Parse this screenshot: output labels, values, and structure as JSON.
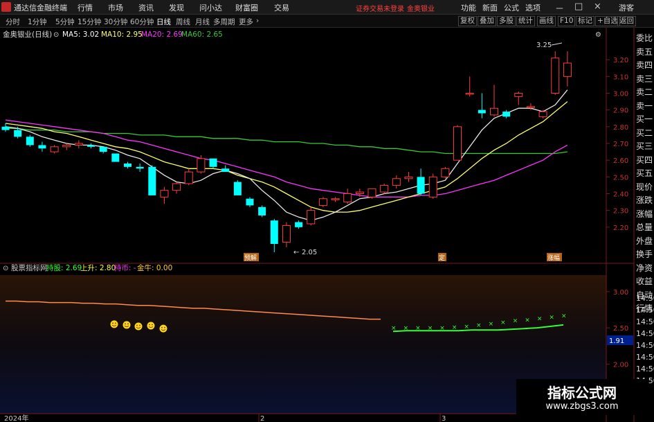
{
  "app": {
    "title": "通达信金融终端"
  },
  "menu": [
    "行情",
    "市场",
    "资讯",
    "发现",
    "问小达",
    "财富圈",
    "交易"
  ],
  "warning": {
    "text": "证券交易未登录",
    "stock_name": "金奥银业"
  },
  "topright": [
    "功能",
    "新面",
    "公式",
    "选项",
    "游客"
  ],
  "window_controls": [
    "－",
    "□",
    "×"
  ],
  "periods": [
    "分时",
    "1分钟",
    "5分钟",
    "15分钟",
    "30分钟",
    "60分钟",
    "日线",
    "周线",
    "月线",
    "多周期",
    "更多"
  ],
  "active_period": "日线",
  "tools": [
    "复权",
    "叠加",
    "多股",
    "统计",
    "画线",
    "F10",
    "标记",
    "+自选",
    "返回"
  ],
  "legend": {
    "stock_label": "金奥银业(日线)",
    "ma5_label": "MA5: 3.02",
    "ma10_label": "MA10: 2.95",
    "ma20_label": "MA20: 2.69",
    "ma60_label": "MA60: 2.65"
  },
  "price_axis": [
    "3.20",
    "3.10",
    "3.00",
    "2.90",
    "2.80",
    "2.70",
    "2.60",
    "2.50",
    "2.40",
    "2.30",
    "2.20"
  ],
  "annotations": {
    "high": "3.25",
    "low": "2.05",
    "tag1": "预解",
    "tag2": "定",
    "tag3": "涨幅"
  },
  "indicator": {
    "name": "股票指标网",
    "line1_label": "持股: 2.69",
    "line2_label": "上升: 2.80",
    "line3_label": "持币: -",
    "line4_label": "金牛: 0.00",
    "axis": [
      "3.00",
      "2.50",
      "2.00",
      "1.50"
    ],
    "current_value": "1.91"
  },
  "time_axis": [
    "2024年",
    "2",
    "3"
  ],
  "side_panel": [
    "委比",
    "卖五",
    "卖四",
    "卖三",
    "卖二",
    "卖一",
    "买一",
    "买二",
    "买三",
    "买四",
    "买五",
    "现价",
    "涨跌",
    "涨幅",
    "总量",
    "外盘",
    "换手",
    "净资",
    "收益",
    "自动",
    "行情"
  ],
  "side_times": [
    "14:50",
    "14:50",
    "14:50",
    "14:50",
    "14:50",
    "14:50",
    "14:50",
    "14:50"
  ],
  "watermark": {
    "title": "指标公式网",
    "url": "www.zbgs3.com"
  },
  "colors": {
    "up": "#ff3c3c",
    "down": "#00ffff",
    "ma5": "#ffffff",
    "ma10": "#ffff66",
    "ma20": "#ff33ff",
    "ma60": "#33cc33",
    "hold": "#ff8c4a",
    "rise": "#33ff33"
  },
  "chart_data": {
    "type": "candlestick",
    "candles": [
      {
        "o": 2.8,
        "h": 2.82,
        "l": 2.77,
        "c": 2.78
      },
      {
        "o": 2.78,
        "h": 2.8,
        "l": 2.73,
        "c": 2.74
      },
      {
        "o": 2.74,
        "h": 2.75,
        "l": 2.68,
        "c": 2.69
      },
      {
        "o": 2.69,
        "h": 2.71,
        "l": 2.65,
        "c": 2.67
      },
      {
        "o": 2.65,
        "h": 2.69,
        "l": 2.64,
        "c": 2.68
      },
      {
        "o": 2.68,
        "h": 2.7,
        "l": 2.66,
        "c": 2.69
      },
      {
        "o": 2.69,
        "h": 2.72,
        "l": 2.67,
        "c": 2.7
      },
      {
        "o": 2.69,
        "h": 2.7,
        "l": 2.67,
        "c": 2.68
      },
      {
        "o": 2.68,
        "h": 2.68,
        "l": 2.64,
        "c": 2.65
      },
      {
        "o": 2.64,
        "h": 2.64,
        "l": 2.59,
        "c": 2.59
      },
      {
        "o": 2.58,
        "h": 2.59,
        "l": 2.55,
        "c": 2.56
      },
      {
        "o": 2.56,
        "h": 2.58,
        "l": 2.53,
        "c": 2.55
      },
      {
        "o": 2.56,
        "h": 2.57,
        "l": 2.49,
        "c": 2.39
      },
      {
        "o": 2.38,
        "h": 2.44,
        "l": 2.34,
        "c": 2.42
      },
      {
        "o": 2.42,
        "h": 2.47,
        "l": 2.4,
        "c": 2.46
      },
      {
        "o": 2.46,
        "h": 2.55,
        "l": 2.45,
        "c": 2.53
      },
      {
        "o": 2.53,
        "h": 2.63,
        "l": 2.52,
        "c": 2.61
      },
      {
        "o": 2.61,
        "h": 2.61,
        "l": 2.55,
        "c": 2.56
      },
      {
        "o": 2.55,
        "h": 2.57,
        "l": 2.53,
        "c": 2.53
      },
      {
        "o": 2.47,
        "h": 2.48,
        "l": 2.39,
        "c": 2.39
      },
      {
        "o": 2.37,
        "h": 2.38,
        "l": 2.32,
        "c": 2.33
      },
      {
        "o": 2.32,
        "h": 2.33,
        "l": 2.26,
        "c": 2.27
      },
      {
        "o": 2.24,
        "h": 2.25,
        "l": 2.05,
        "c": 2.1
      },
      {
        "o": 2.11,
        "h": 2.23,
        "l": 2.08,
        "c": 2.21
      },
      {
        "o": 2.23,
        "h": 2.24,
        "l": 2.19,
        "c": 2.2
      },
      {
        "o": 2.22,
        "h": 2.32,
        "l": 2.21,
        "c": 2.3
      },
      {
        "o": 2.33,
        "h": 2.38,
        "l": 2.32,
        "c": 2.37
      },
      {
        "o": 2.37,
        "h": 2.38,
        "l": 2.35,
        "c": 2.37
      },
      {
        "o": 2.35,
        "h": 2.43,
        "l": 2.34,
        "c": 2.4
      },
      {
        "o": 2.4,
        "h": 2.43,
        "l": 2.38,
        "c": 2.41
      },
      {
        "o": 2.38,
        "h": 2.43,
        "l": 2.37,
        "c": 2.43
      },
      {
        "o": 2.41,
        "h": 2.46,
        "l": 2.4,
        "c": 2.45
      },
      {
        "o": 2.45,
        "h": 2.51,
        "l": 2.43,
        "c": 2.49
      },
      {
        "o": 2.49,
        "h": 2.53,
        "l": 2.47,
        "c": 2.5
      },
      {
        "o": 2.5,
        "h": 2.55,
        "l": 2.39,
        "c": 2.4
      },
      {
        "o": 2.38,
        "h": 2.52,
        "l": 2.37,
        "c": 2.5
      },
      {
        "o": 2.5,
        "h": 2.56,
        "l": 2.49,
        "c": 2.55
      },
      {
        "o": 2.6,
        "h": 2.81,
        "l": 2.6,
        "c": 2.8
      },
      {
        "o": 3.0,
        "h": 3.1,
        "l": 2.98,
        "c": 3.0
      },
      {
        "o": 2.9,
        "h": 3.0,
        "l": 2.85,
        "c": 2.88
      },
      {
        "o": 2.87,
        "h": 3.05,
        "l": 2.86,
        "c": 2.91
      },
      {
        "o": 2.89,
        "h": 2.9,
        "l": 2.85,
        "c": 2.86
      },
      {
        "o": 2.98,
        "h": 3.01,
        "l": 2.93,
        "c": 3.0
      },
      {
        "o": 2.92,
        "h": 2.94,
        "l": 2.9,
        "c": 2.92
      },
      {
        "o": 2.86,
        "h": 2.9,
        "l": 2.85,
        "c": 2.89
      },
      {
        "o": 3.0,
        "h": 3.25,
        "l": 2.99,
        "c": 3.21
      },
      {
        "o": 3.1,
        "h": 3.25,
        "l": 3.04,
        "c": 3.18
      }
    ],
    "ma5": [
      2.8,
      2.79,
      2.77,
      2.74,
      2.72,
      2.7,
      2.69,
      2.69,
      2.68,
      2.66,
      2.63,
      2.61,
      2.56,
      2.51,
      2.47,
      2.46,
      2.48,
      2.52,
      2.54,
      2.52,
      2.49,
      2.42,
      2.36,
      2.29,
      2.26,
      2.24,
      2.26,
      2.29,
      2.33,
      2.37,
      2.38,
      2.4,
      2.41,
      2.43,
      2.45,
      2.46,
      2.48,
      2.58,
      2.68,
      2.78,
      2.85,
      2.88,
      2.91,
      2.91,
      2.89,
      2.93,
      3.02
    ],
    "ma10": [
      2.82,
      2.81,
      2.8,
      2.79,
      2.77,
      2.76,
      2.74,
      2.72,
      2.7,
      2.68,
      2.67,
      2.65,
      2.62,
      2.59,
      2.57,
      2.55,
      2.55,
      2.55,
      2.54,
      2.51,
      2.49,
      2.47,
      2.44,
      2.4,
      2.36,
      2.32,
      2.3,
      2.29,
      2.29,
      2.3,
      2.32,
      2.34,
      2.36,
      2.38,
      2.4,
      2.42,
      2.44,
      2.49,
      2.55,
      2.61,
      2.66,
      2.7,
      2.75,
      2.79,
      2.83,
      2.89,
      2.95
    ],
    "ma20": [
      2.84,
      2.83,
      2.82,
      2.81,
      2.8,
      2.79,
      2.78,
      2.77,
      2.76,
      2.74,
      2.72,
      2.71,
      2.69,
      2.67,
      2.65,
      2.63,
      2.61,
      2.6,
      2.58,
      2.56,
      2.54,
      2.52,
      2.5,
      2.47,
      2.45,
      2.43,
      2.42,
      2.41,
      2.4,
      2.39,
      2.38,
      2.38,
      2.38,
      2.38,
      2.39,
      2.39,
      2.4,
      2.42,
      2.44,
      2.46,
      2.48,
      2.51,
      2.54,
      2.57,
      2.6,
      2.65,
      2.69
    ],
    "ma60": [
      2.79,
      2.79,
      2.78,
      2.78,
      2.78,
      2.77,
      2.77,
      2.77,
      2.76,
      2.76,
      2.76,
      2.75,
      2.75,
      2.75,
      2.74,
      2.74,
      2.74,
      2.73,
      2.73,
      2.73,
      2.72,
      2.72,
      2.71,
      2.71,
      2.71,
      2.7,
      2.7,
      2.69,
      2.69,
      2.68,
      2.68,
      2.67,
      2.67,
      2.66,
      2.65,
      2.65,
      2.64,
      2.64,
      2.64,
      2.64,
      2.64,
      2.64,
      2.64,
      2.64,
      2.64,
      2.64,
      2.65
    ],
    "hold_line": [
      2.87,
      2.87,
      2.86,
      2.86,
      2.85,
      2.85,
      2.85,
      2.84,
      2.84,
      2.83,
      2.83,
      2.82,
      2.81,
      2.81,
      2.8,
      2.79,
      2.78,
      2.77,
      2.77,
      2.76,
      2.75,
      2.74,
      2.73,
      2.72,
      2.71,
      2.7,
      2.69,
      2.68,
      2.67,
      2.66,
      2.65,
      2.64,
      2.63,
      2.62,
      2.62
    ],
    "rise_line": [
      2.45,
      2.46,
      2.46,
      2.46,
      2.46,
      2.46,
      2.47,
      2.47,
      2.47,
      2.48,
      2.49,
      2.5,
      2.52,
      2.54
    ],
    "smiley_y": [
      2.55,
      2.54,
      2.52,
      2.53,
      2.49
    ],
    "cross_y": [
      2.5,
      2.5,
      2.5,
      2.5,
      2.5,
      2.51,
      2.52,
      2.54,
      2.56,
      2.58,
      2.6,
      2.61,
      2.63,
      2.65,
      2.67
    ],
    "price_range": [
      2.1,
      3.3
    ],
    "indicator_range": [
      1.4,
      3.2
    ]
  }
}
